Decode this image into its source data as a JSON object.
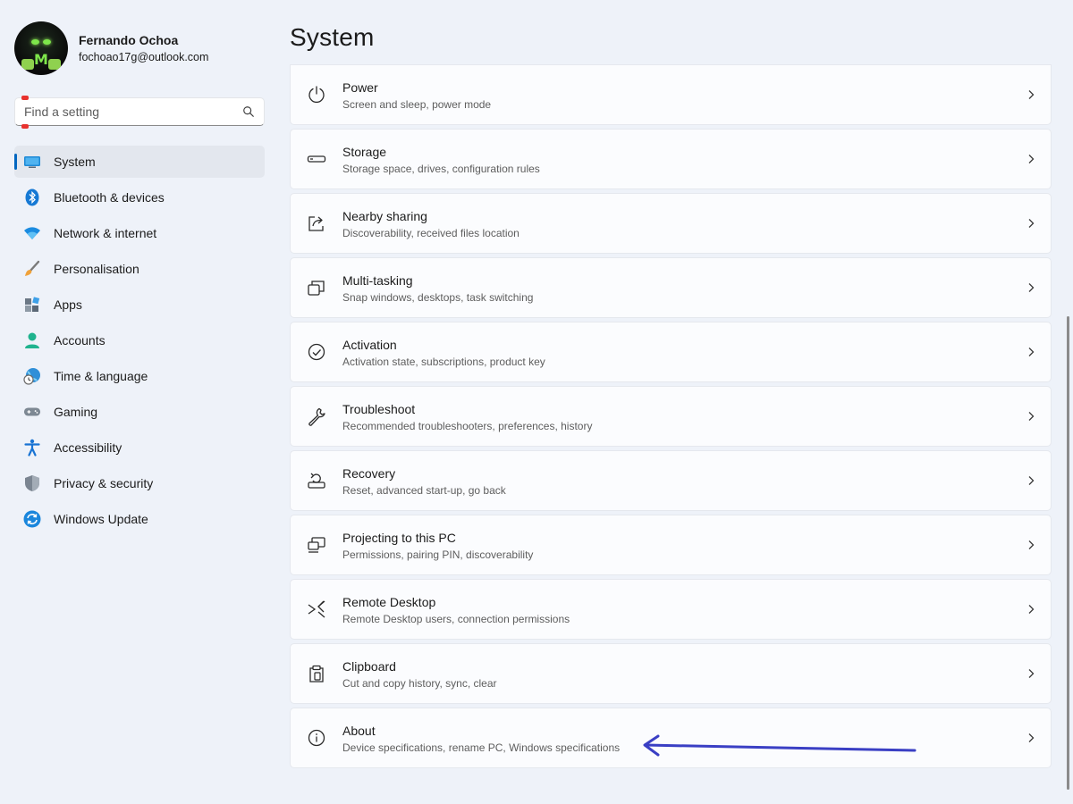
{
  "profile": {
    "name": "Fernando Ochoa",
    "email": "fochoao17g@outlook.com"
  },
  "search": {
    "placeholder": "Find a setting"
  },
  "nav": {
    "items": [
      {
        "label": "System",
        "icon": "monitor-icon",
        "active": true
      },
      {
        "label": "Bluetooth & devices",
        "icon": "bluetooth-icon"
      },
      {
        "label": "Network & internet",
        "icon": "wifi-icon"
      },
      {
        "label": "Personalisation",
        "icon": "brush-icon"
      },
      {
        "label": "Apps",
        "icon": "apps-icon"
      },
      {
        "label": "Accounts",
        "icon": "person-icon"
      },
      {
        "label": "Time & language",
        "icon": "globe-clock-icon"
      },
      {
        "label": "Gaming",
        "icon": "gamepad-icon"
      },
      {
        "label": "Accessibility",
        "icon": "accessibility-icon"
      },
      {
        "label": "Privacy & security",
        "icon": "shield-icon"
      },
      {
        "label": "Windows Update",
        "icon": "update-icon"
      }
    ]
  },
  "page": {
    "title": "System"
  },
  "settings": [
    {
      "title": "Power",
      "subtitle": "Screen and sleep, power mode",
      "icon": "power-icon"
    },
    {
      "title": "Storage",
      "subtitle": "Storage space, drives, configuration rules",
      "icon": "storage-icon"
    },
    {
      "title": "Nearby sharing",
      "subtitle": "Discoverability, received files location",
      "icon": "share-icon"
    },
    {
      "title": "Multi-tasking",
      "subtitle": "Snap windows, desktops, task switching",
      "icon": "multitask-icon"
    },
    {
      "title": "Activation",
      "subtitle": "Activation state, subscriptions, product key",
      "icon": "check-circle-icon"
    },
    {
      "title": "Troubleshoot",
      "subtitle": "Recommended troubleshooters, preferences, history",
      "icon": "wrench-icon"
    },
    {
      "title": "Recovery",
      "subtitle": "Reset, advanced start-up, go back",
      "icon": "recovery-icon"
    },
    {
      "title": "Projecting to this PC",
      "subtitle": "Permissions, pairing PIN, discoverability",
      "icon": "projecting-icon"
    },
    {
      "title": "Remote Desktop",
      "subtitle": "Remote Desktop users, connection permissions",
      "icon": "remote-desktop-icon"
    },
    {
      "title": "Clipboard",
      "subtitle": "Cut and copy history, sync, clear",
      "icon": "clipboard-icon"
    },
    {
      "title": "About",
      "subtitle": "Device specifications, rename PC, Windows specifications",
      "icon": "info-icon"
    }
  ],
  "colors": {
    "accent": "#0067c0",
    "annotation_arrow": "#3a3fc4"
  }
}
